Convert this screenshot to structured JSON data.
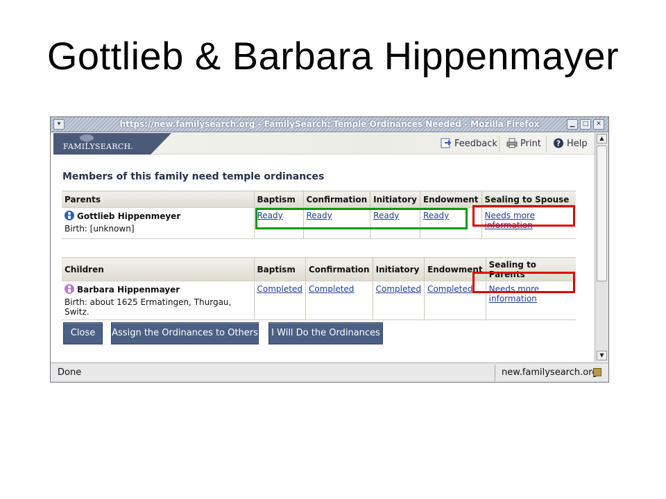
{
  "slide": {
    "title": "Gottlieb & Barbara Hippenmayer"
  },
  "window": {
    "title": "https://new.familysearch.org - FamilySearch: Temple Ordinances Needed - Mozilla Firefox",
    "minimize": "▁",
    "maximize": "□",
    "close": "✕",
    "menu": "▾"
  },
  "header": {
    "logo": "FAMILYSEARCH.",
    "feedback": "Feedback",
    "print": "Print",
    "help": "Help"
  },
  "main": {
    "heading": "Members of this family need temple ordinances",
    "parents_table": {
      "headers": [
        "Parents",
        "Baptism",
        "Confirmation",
        "Initiatory",
        "Endowment",
        "Sealing to Spouse"
      ],
      "row": {
        "name": "Gottlieb Hippenmeyer",
        "birth": "Birth: [unknown]",
        "baptism": "Ready",
        "confirmation": "Ready",
        "initiatory": "Ready",
        "endowment": "Ready",
        "sealing": "Needs more information"
      }
    },
    "children_table": {
      "headers": [
        "Children",
        "Baptism",
        "Confirmation",
        "Initiatory",
        "Endowment",
        "Sealing to Parents"
      ],
      "row": {
        "name": "Barbara Hippenmayer",
        "birth": "Birth: about 1625 Ermatingen, Thurgau, Switz.",
        "baptism": "Completed",
        "confirmation": "Completed",
        "initiatory": "Completed",
        "endowment": "Completed",
        "sealing": "Needs more information"
      }
    },
    "buttons": {
      "close": "Close",
      "assign": "Assign the Ordinances to Others",
      "do": "I Will Do the Ordinances"
    }
  },
  "statusbar": {
    "left": "Done",
    "right": "new.familysearch.org"
  },
  "colors": {
    "highlight_green": "#0b9a0b",
    "highlight_red": "#e00000",
    "button": "#4c5f85"
  }
}
